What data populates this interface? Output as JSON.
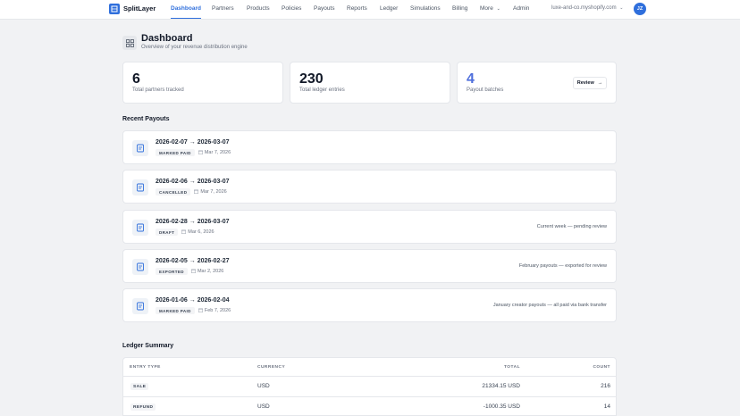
{
  "brand": {
    "name": "SplitLayer",
    "color": "#2f6fdc"
  },
  "nav": {
    "items": [
      "Dashboard",
      "Partners",
      "Products",
      "Policies",
      "Payouts",
      "Reports",
      "Ledger",
      "Simulations",
      "Billing",
      "More",
      "Admin"
    ],
    "active": "Dashboard",
    "store": "luxe-and-co.myshopify.com",
    "avatar": "JZ"
  },
  "header": {
    "title": "Dashboard",
    "subtitle": "Overview of your revenue distribution engine",
    "icon": "grid-icon"
  },
  "stats": [
    {
      "value": "6",
      "label": "Total partners tracked"
    },
    {
      "value": "230",
      "label": "Total ledger entries"
    },
    {
      "value": "4",
      "label": "Payout batches",
      "action": "Review"
    }
  ],
  "recent_payouts": {
    "title": "Recent Payouts",
    "rows": [
      {
        "range": "2026-02-07 → 2026-03-07",
        "status": "MARKED PAID",
        "date": "Mar 7, 2026",
        "note": ""
      },
      {
        "range": "2026-02-06 → 2026-03-07",
        "status": "CANCELLED",
        "date": "Mar 7, 2026",
        "note": ""
      },
      {
        "range": "2026-02-28 → 2026-03-07",
        "status": "DRAFT",
        "date": "Mar 6, 2026",
        "note": "Current week — pending review"
      },
      {
        "range": "2026-02-05 → 2026-02-27",
        "status": "EXPORTED",
        "date": "Mar 2, 2026",
        "note": "February payouts — exported for review"
      },
      {
        "range": "2026-01-06 → 2026-02-04",
        "status": "MARKED PAID",
        "date": "Feb 7, 2026",
        "note": "January creator payouts — all paid via bank transfer"
      }
    ]
  },
  "ledger_summary": {
    "title": "Ledger Summary",
    "columns": [
      "ENTRY TYPE",
      "CURRENCY",
      "TOTAL",
      "COUNT"
    ],
    "rows": [
      {
        "type": "SALE",
        "currency": "USD",
        "total": "21334.15 USD",
        "count": "216"
      },
      {
        "type": "REFUND",
        "currency": "USD",
        "total": "-1000.35 USD",
        "count": "14"
      }
    ]
  }
}
